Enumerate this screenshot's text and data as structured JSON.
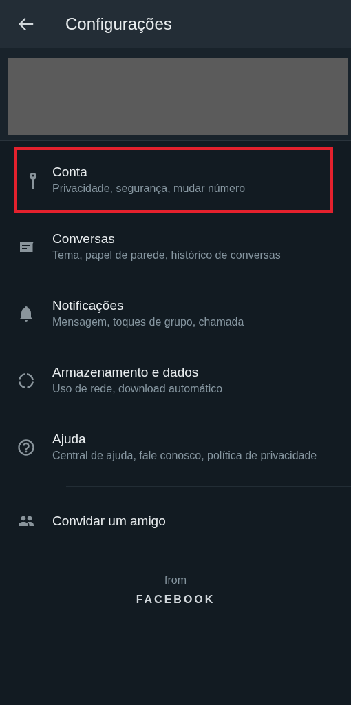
{
  "header": {
    "title": "Configurações"
  },
  "profile": {
    "kind": "redacted"
  },
  "items": [
    {
      "title": "Conta",
      "subtitle": "Privacidade, segurança, mudar número",
      "highlighted": true
    },
    {
      "title": "Conversas",
      "subtitle": "Tema, papel de parede, histórico de conversas",
      "highlighted": false
    },
    {
      "title": "Notificações",
      "subtitle": "Mensagem, toques de grupo, chamada",
      "highlighted": false
    },
    {
      "title": "Armazenamento e dados",
      "subtitle": "Uso de rede, download automático",
      "highlighted": false
    },
    {
      "title": "Ajuda",
      "subtitle": "Central de ajuda, fale conosco, política de privacidade",
      "highlighted": false
    }
  ],
  "invite": {
    "title": "Convidar um amigo"
  },
  "footer": {
    "from": "from",
    "brand": "FACEBOOK"
  }
}
